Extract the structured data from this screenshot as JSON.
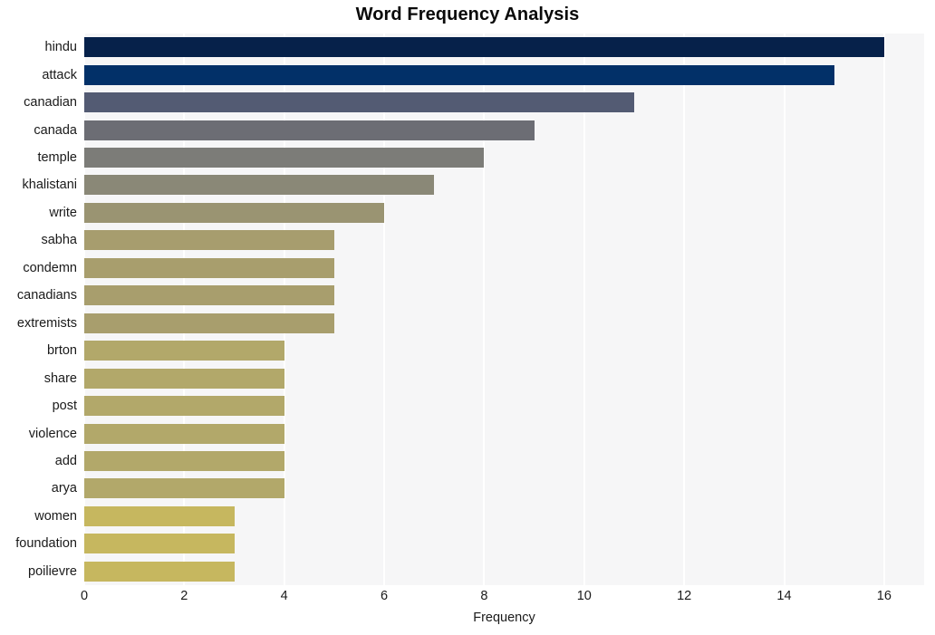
{
  "chart_data": {
    "type": "bar",
    "orientation": "horizontal",
    "title": "Word Frequency Analysis",
    "xlabel": "Frequency",
    "ylabel": "",
    "xlim": [
      0,
      16.8
    ],
    "xticks": [
      0,
      2,
      4,
      6,
      8,
      10,
      12,
      14,
      16
    ],
    "xticklabels": [
      "0",
      "2",
      "4",
      "6",
      "8",
      "10",
      "12",
      "14",
      "16"
    ],
    "grid": "vertical-only",
    "legend": "none",
    "background": "#f6f6f7",
    "gridline_color": "#ffffff",
    "categories": [
      "hindu",
      "attack",
      "canadian",
      "canada",
      "temple",
      "khalistani",
      "write",
      "sabha",
      "condemn",
      "canadians",
      "extremists",
      "brton",
      "share",
      "post",
      "violence",
      "add",
      "arya",
      "women",
      "foundation",
      "poilievre"
    ],
    "values": [
      16,
      15,
      11,
      9,
      8,
      7,
      6,
      5,
      5,
      5,
      5,
      4,
      4,
      4,
      4,
      4,
      4,
      3,
      3,
      3
    ],
    "bar_colors": [
      "#06214a",
      "#023068",
      "#535b73",
      "#6c6d74",
      "#7c7c78",
      "#8a8877",
      "#9a9472",
      "#a79d6e",
      "#a89e6d",
      "#a89e6d",
      "#a89e6d",
      "#b2a86a",
      "#b2a86a",
      "#b2a86a",
      "#b2a86a",
      "#b2a86a",
      "#b2a86a",
      "#c6b75f",
      "#c6b75f",
      "#c6b75f"
    ]
  }
}
